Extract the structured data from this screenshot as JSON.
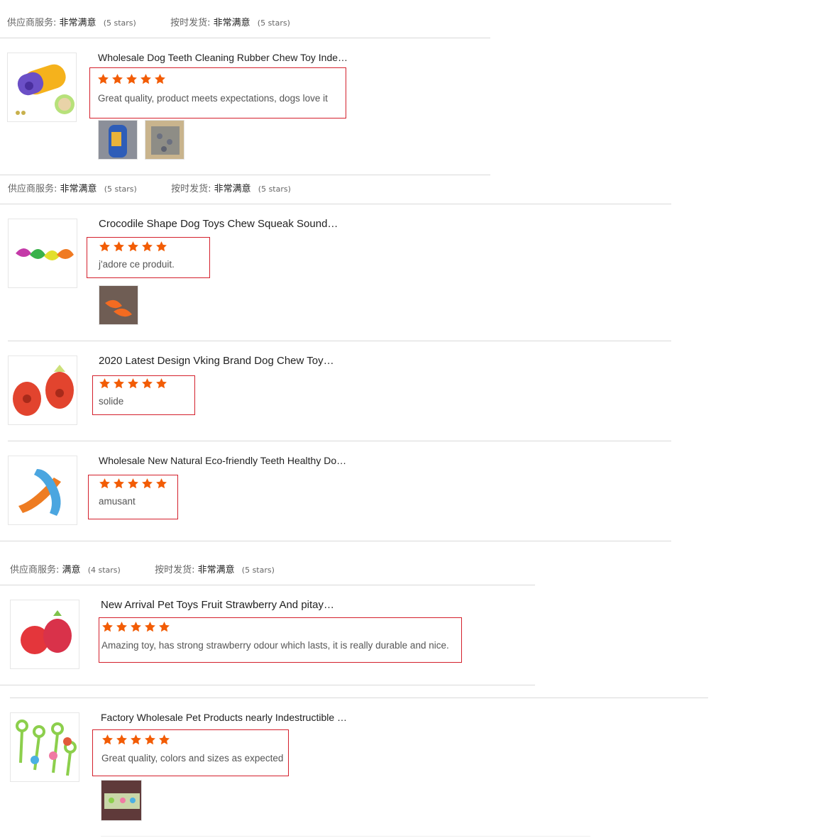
{
  "colors": {
    "star": "#f25c05",
    "box": "#d4202c",
    "divider": "#d9d9d9"
  },
  "meta_rows": [
    {
      "service_label": "供应商服务:",
      "service_value": "非常满意",
      "service_stars": "(5 stars)",
      "shipping_label": "按时发货:",
      "shipping_value": "非常满意",
      "shipping_stars": "(5 stars)"
    },
    {
      "service_label": "供应商服务:",
      "service_value": "非常满意",
      "service_stars": "(5 stars)",
      "shipping_label": "按时发货:",
      "shipping_value": "非常满意",
      "shipping_stars": "(5 stars)"
    },
    {
      "service_label": "供应商服务:",
      "service_value": "满意",
      "service_stars": "(4 stars)",
      "shipping_label": "按时发货:",
      "shipping_value": "非常满意",
      "shipping_stars": "(5 stars)"
    }
  ],
  "reviews": [
    {
      "title": "Wholesale Dog Teeth Cleaning Rubber Chew Toy Inde…",
      "rating": 5,
      "text": "Great quality, product meets expectations, dogs love it",
      "product_image": "dog-chew-toy-purple-yellow",
      "photos": [
        "photo-toy-blue",
        "photo-boxes"
      ]
    },
    {
      "title": "Crocodile Shape Dog Toys Chew Squeak Sound…",
      "rating": 5,
      "text": "j'adore ce produit.",
      "product_image": "crocodile-toys",
      "photos": [
        "photo-crocodiles"
      ]
    },
    {
      "title": "2020 Latest Design Vking Brand Dog Chew Toy…",
      "rating": 5,
      "text": "solide",
      "product_image": "red-dragon-fruit-toy",
      "photos": []
    },
    {
      "title": "Wholesale New Natural Eco-friendly Teeth Healthy Do…",
      "rating": 5,
      "text": "amusant",
      "product_image": "bone-toys-orange-blue",
      "photos": []
    },
    {
      "title": "New Arrival Pet Toys Fruit Strawberry And pitay…",
      "rating": 5,
      "text": "Amazing toy, has strong strawberry odour which lasts, it is really durable and nice.",
      "product_image": "strawberry-pitaya-toys",
      "photos": []
    },
    {
      "title": "Factory Wholesale Pet Products nearly Indestructible …",
      "rating": 5,
      "text": "Great quality, colors and sizes as expected",
      "product_image": "rope-toys-set",
      "photos": [
        "photo-rope-toys"
      ]
    }
  ]
}
